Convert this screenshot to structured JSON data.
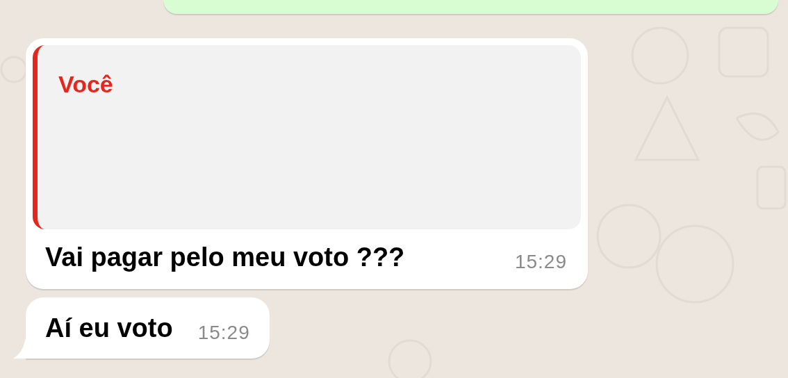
{
  "messages": [
    {
      "kind": "outgoing_cut"
    },
    {
      "kind": "incoming",
      "quote": {
        "author": "Você",
        "color": "#e5261d"
      },
      "text": "Vai pagar pelo meu voto ???",
      "time": "15:29",
      "tail": false
    },
    {
      "kind": "incoming",
      "text": "Aí eu voto",
      "time": "15:29",
      "tail": true
    }
  ]
}
